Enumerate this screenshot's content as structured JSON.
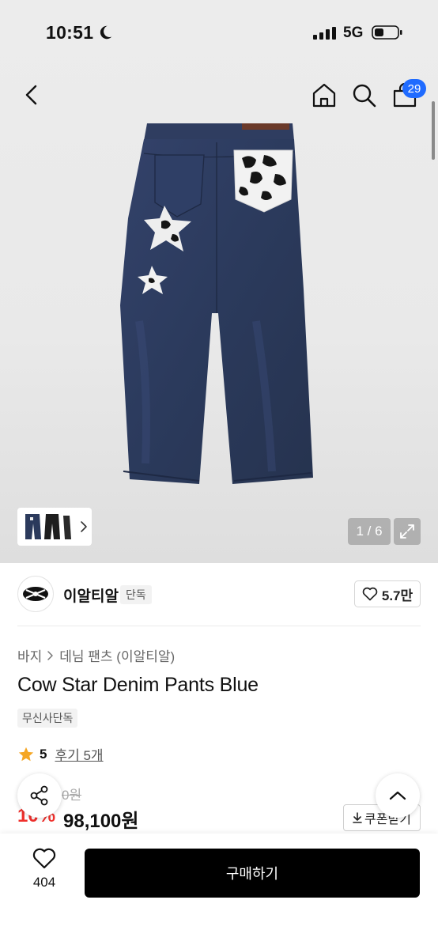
{
  "status_bar": {
    "time": "10:51",
    "network": "5G"
  },
  "header": {
    "cart_count": "29"
  },
  "gallery": {
    "page_indicator": "1 / 6"
  },
  "brand": {
    "name": "이알티알",
    "badge": "단독",
    "like_count": "5.7만"
  },
  "breadcrumb": {
    "category": "바지",
    "subcategory": "데님 팬츠 (이알티알)"
  },
  "product": {
    "title": "Cow Star Denim Pants Blue",
    "exclusive_label": "무신사단독",
    "rating": "5",
    "review_label": "후기 5개",
    "original_price": "0원",
    "discount": "10%",
    "price": "98,100원",
    "coupon_label": "쿠폰받기"
  },
  "bottom_bar": {
    "wish_count": "404",
    "buy_label": "구매하기"
  },
  "colors": {
    "accent_blue": "#1f6bff",
    "discount_red": "#f0302c",
    "star": "#f5a623",
    "denim": "#2b3a5c"
  }
}
